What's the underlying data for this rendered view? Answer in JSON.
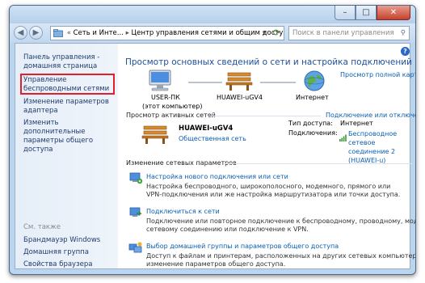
{
  "window": {
    "controls": {
      "minimize": "–",
      "maximize": "□",
      "close": "✕"
    }
  },
  "address": {
    "path_icon": "network-folder-icon",
    "crumb1": "Сеть и Инте...",
    "crumb2": "Центр управления сетями и общим доступом",
    "search_placeholder": "Поиск в панели управления"
  },
  "sidebar": {
    "items": [
      {
        "label": "Панель управления - домашняя страница"
      },
      {
        "label": "Управление беспроводными сетями"
      },
      {
        "label": "Изменение параметров адаптера"
      },
      {
        "label": "Изменить дополнительные параметры общего доступа"
      }
    ],
    "see_also_title": "См. также",
    "see_also": [
      {
        "label": "Брандмауэр Windows"
      },
      {
        "label": "Домашняя группа"
      },
      {
        "label": "Свойства браузера"
      }
    ],
    "highlight_color": "#e0202a"
  },
  "main": {
    "title": "Просмотр основных сведений о сети и настройка подключений",
    "full_map": "Просмотр полной карты",
    "map": {
      "pc_name": "USER-ПК",
      "pc_sub": "(этот компьютер)",
      "net_name": "HUAWEI-uGV4",
      "internet": "Интернет"
    },
    "active_title": "Просмотр активных сетей",
    "connect_disconnect": "Подключение или отключение",
    "network": {
      "name": "HUAWEI-uGV4",
      "type": "Общественная сеть",
      "access_label": "Тип доступа:",
      "access_value": "Интернет",
      "conn_label": "Подключения:",
      "conn_value": "Беспроводное сетевое соединение 2 (HUAWEI-u)"
    },
    "change_title": "Изменение сетевых параметров",
    "tasks": [
      {
        "title": "Настройка нового подключения или сети",
        "desc1": "Настройка беспроводного, широкополосного, модемного, прямого или",
        "desc2": "VPN-подключения или же настройка маршрутизатора или точки доступа."
      },
      {
        "title": "Подключиться к сети",
        "desc1": "Подключение или повторное подключение к беспроводному, проводному, модемному",
        "desc2": "сетевому соединению или подключение к VPN."
      },
      {
        "title": "Выбор домашней группы и параметров общего доступа",
        "desc1": "Доступ к файлам и принтерам, расположенных на других сетевых компьютерах, или",
        "desc2": "изменение параметров общего доступа."
      }
    ]
  }
}
